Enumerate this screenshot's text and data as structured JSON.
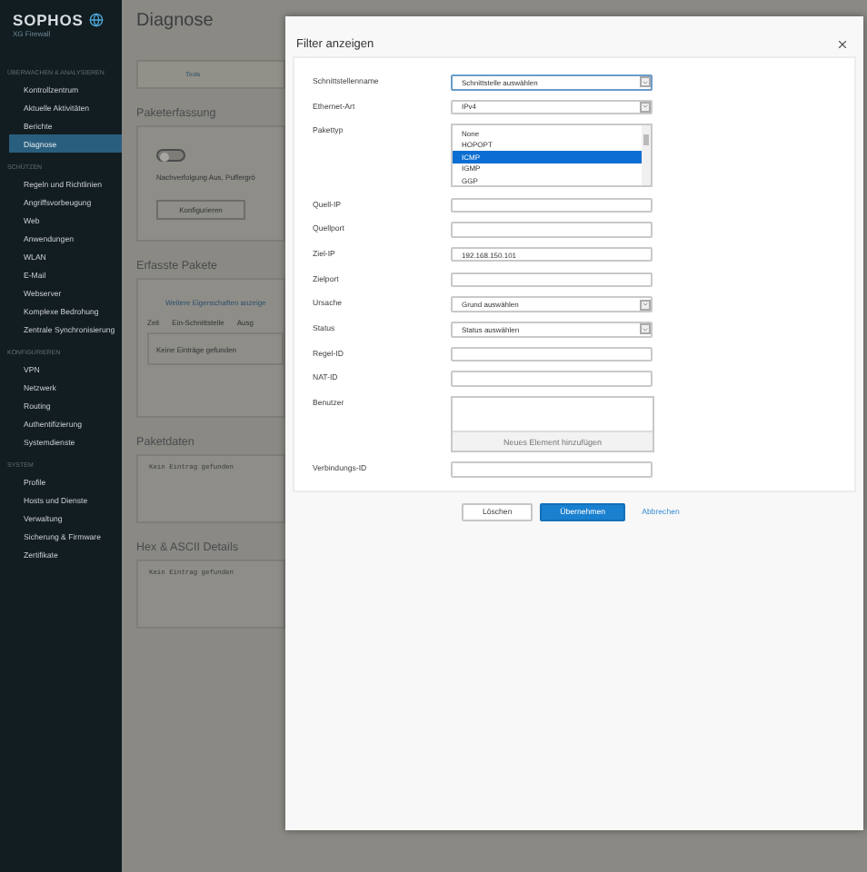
{
  "sidebar": {
    "logo": "SOPHOS",
    "product": "XG Firewall",
    "sections": [
      {
        "title": "ÜBERWACHEN & ANALYSIEREN",
        "items": [
          {
            "label": "Kontrollzentrum",
            "selected": false
          },
          {
            "label": "Aktuelle Aktivitäten",
            "selected": false
          },
          {
            "label": "Berichte",
            "selected": false
          },
          {
            "label": "Diagnose",
            "selected": true
          }
        ]
      },
      {
        "title": "SCHÜTZEN",
        "items": [
          {
            "label": "Regeln und Richtlinien",
            "selected": false
          },
          {
            "label": "Angriffsvorbeugung",
            "selected": false
          },
          {
            "label": "Web",
            "selected": false
          },
          {
            "label": "Anwendungen",
            "selected": false
          },
          {
            "label": "WLAN",
            "selected": false
          },
          {
            "label": "E-Mail",
            "selected": false
          },
          {
            "label": "Webserver",
            "selected": false
          },
          {
            "label": "Komplexe Bedrohung",
            "selected": false
          },
          {
            "label": "Zentrale Synchronisierung",
            "selected": false
          }
        ]
      },
      {
        "title": "KONFIGURIEREN",
        "items": [
          {
            "label": "VPN",
            "selected": false
          },
          {
            "label": "Netzwerk",
            "selected": false
          },
          {
            "label": "Routing",
            "selected": false
          },
          {
            "label": "Authentifizierung",
            "selected": false
          },
          {
            "label": "Systemdienste",
            "selected": false
          }
        ]
      },
      {
        "title": "SYSTEM",
        "items": [
          {
            "label": "Profile",
            "selected": false
          },
          {
            "label": "Hosts und Dienste",
            "selected": false
          },
          {
            "label": "Verwaltung",
            "selected": false
          },
          {
            "label": "Sicherung & Firmware",
            "selected": false
          },
          {
            "label": "Zertifikate",
            "selected": false
          }
        ]
      }
    ]
  },
  "page": {
    "title": "Diagnose",
    "tabs": [
      {
        "label": "Tools",
        "selected": true
      }
    ],
    "capture": {
      "title": "Paketerfassung",
      "toggle_on": false,
      "status": "Nachverfolgung Aus, Puffergrö",
      "button": "Konfigurieren"
    },
    "packets": {
      "title": "Erfasste Pakete",
      "link": "Weitere Eigenschaften anzeige",
      "columns": [
        "Zeit",
        "Ein-Schnittstelle",
        "Ausg"
      ],
      "empty": "Keine Einträge gefunden"
    },
    "data_panels": [
      {
        "title": "Paketdaten",
        "text": "Kein Eintrag gefunden"
      },
      {
        "title": "Hex & ASCII Details",
        "text": "Kein Eintrag gefunden"
      }
    ]
  },
  "dialog": {
    "title": "Filter anzeigen",
    "fields": [
      {
        "kind": "select",
        "label": "Schnittstellenname",
        "value": "Schnittstelle auswählen",
        "focused": true
      },
      {
        "kind": "select",
        "label": "Ethernet-Art",
        "value": "IPv4",
        "focused": false
      },
      {
        "kind": "listbox",
        "label": "Pakettyp",
        "options": [
          {
            "label": "None",
            "selected": false
          },
          {
            "label": "HOPOPT",
            "selected": false
          },
          {
            "label": "ICMP",
            "selected": true
          },
          {
            "label": "IGMP",
            "selected": false
          },
          {
            "label": "GGP",
            "selected": false
          }
        ]
      },
      {
        "kind": "text",
        "label": "Quell-IP"
      },
      {
        "kind": "text",
        "label": "Quellport"
      },
      {
        "kind": "text",
        "label": "Ziel-IP",
        "value": "192.168.150.101"
      },
      {
        "kind": "text",
        "label": "Zielport"
      },
      {
        "kind": "select",
        "label": "Ursache",
        "value": "Grund auswählen",
        "focused": false
      },
      {
        "kind": "select",
        "label": "Status",
        "value": "Status auswählen",
        "focused": false
      },
      {
        "kind": "text",
        "label": "Regel-ID"
      },
      {
        "kind": "text",
        "label": "NAT-ID"
      },
      {
        "kind": "multi",
        "label": "Benutzer",
        "add": "Neues Element hinzufügen"
      },
      {
        "kind": "text",
        "label": "Verbindungs-ID"
      }
    ],
    "buttons": [
      {
        "kind": "secondary",
        "label": "Löschen"
      },
      {
        "kind": "primary",
        "label": "Übernehmen"
      },
      {
        "kind": "link",
        "label": "Abbrechen"
      }
    ]
  }
}
